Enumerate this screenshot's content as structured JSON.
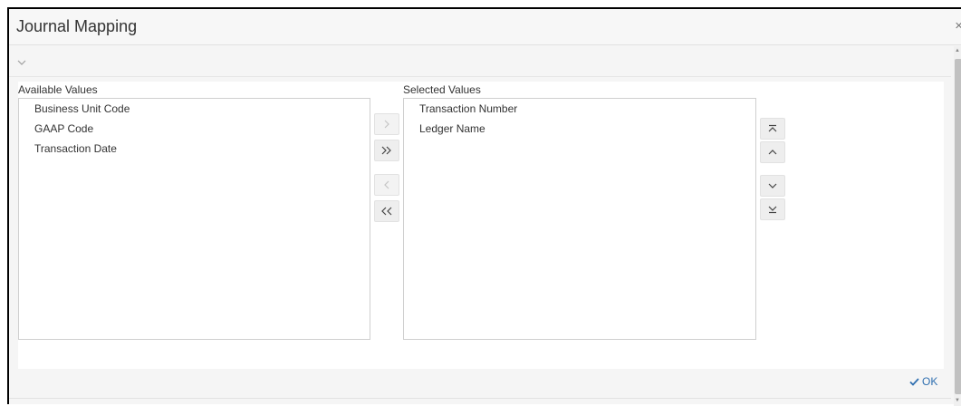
{
  "dialog": {
    "title": "Journal Mapping",
    "close_glyph": "×"
  },
  "available": {
    "label": "Available Values",
    "items": [
      "Business Unit Code",
      "GAAP Code",
      "Transaction Date"
    ]
  },
  "selected": {
    "label": "Selected Values",
    "items": [
      "Transaction Number",
      "Ledger Name"
    ]
  },
  "icons": {
    "collapse": "chevron-down-icon",
    "move_right": "chevron-right-icon",
    "move_all_right": "double-chevron-right-icon",
    "move_left": "chevron-left-icon",
    "move_all_left": "double-chevron-left-icon",
    "move_top": "move-to-top-icon",
    "move_up": "chevron-up-icon",
    "move_down": "chevron-down-icon",
    "move_bottom": "move-to-bottom-icon",
    "ok_check": "checkmark-icon"
  },
  "footer": {
    "ok_label": "OK"
  },
  "colors": {
    "accent": "#2f6fb0",
    "disabled": "#c4c4c4"
  }
}
